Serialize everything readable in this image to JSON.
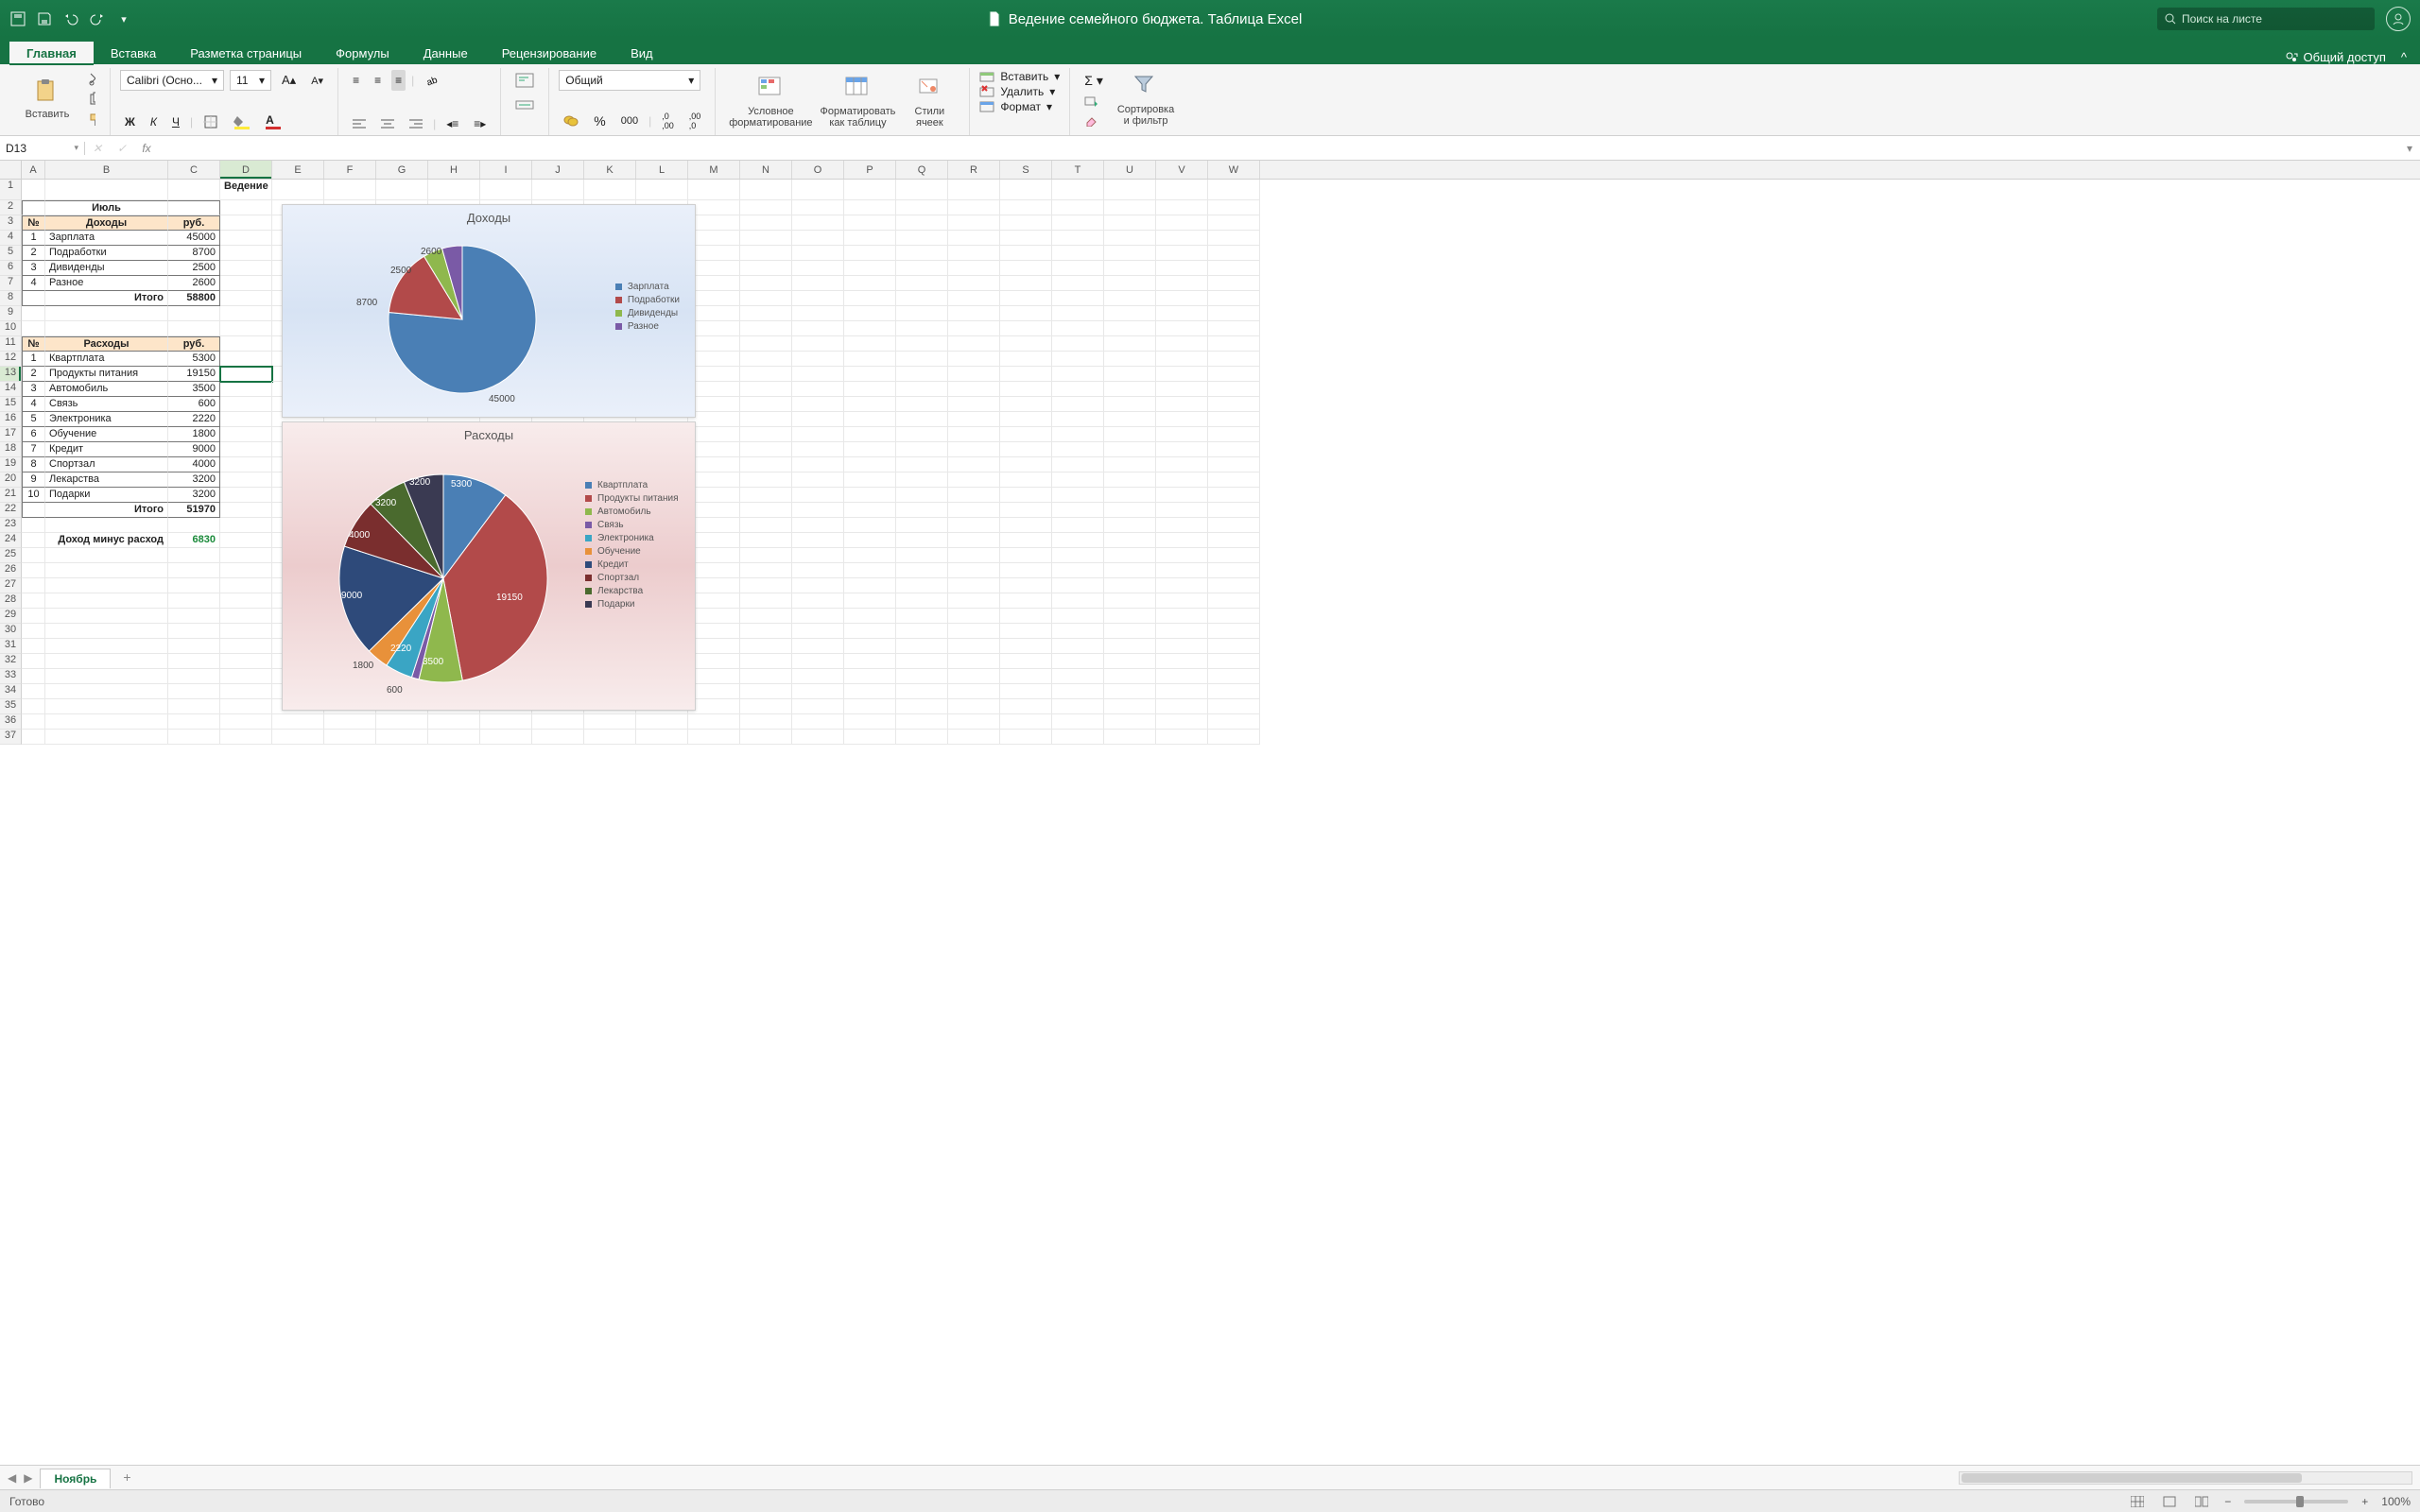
{
  "app": {
    "title": "Ведение семейного бюджета. Таблица Excel",
    "search_placeholder": "Поиск на листе"
  },
  "tabs": [
    "Главная",
    "Вставка",
    "Разметка страницы",
    "Формулы",
    "Данные",
    "Рецензирование",
    "Вид"
  ],
  "share_label": "Общий доступ",
  "ribbon": {
    "paste": "Вставить",
    "font_name": "Calibri (Осно...",
    "font_size": "11",
    "number_format": "Общий",
    "cond_fmt": "Условное\nформатирование",
    "fmt_table": "Форматировать\nкак таблицу",
    "cell_styles": "Стили\nячеек",
    "insert": "Вставить",
    "delete": "Удалить",
    "format": "Формат",
    "sort_filter": "Сортировка\nи фильтр"
  },
  "namebox": "D13",
  "columns": [
    "A",
    "B",
    "C",
    "D",
    "E",
    "F",
    "G",
    "H",
    "I",
    "J",
    "K",
    "L",
    "M",
    "N",
    "O",
    "P",
    "Q",
    "R",
    "S",
    "T",
    "U",
    "V",
    "W"
  ],
  "active": {
    "col": "D",
    "row": 13
  },
  "sheet": {
    "title_cell": "Ведение семейного бюджета в Excel",
    "month": "Июль",
    "income_hdr": {
      "n": "№",
      "name": "Доходы",
      "val": "руб."
    },
    "income": [
      {
        "n": 1,
        "name": "Зарплата",
        "val": 45000
      },
      {
        "n": 2,
        "name": "Подработки",
        "val": 8700
      },
      {
        "n": 3,
        "name": "Дивиденды",
        "val": 2500
      },
      {
        "n": 4,
        "name": "Разное",
        "val": 2600
      }
    ],
    "income_total_label": "Итого",
    "income_total": 58800,
    "expense_hdr": {
      "n": "№",
      "name": "Расходы",
      "val": "руб."
    },
    "expense": [
      {
        "n": 1,
        "name": "Квартплата",
        "val": 5300
      },
      {
        "n": 2,
        "name": "Продукты питания",
        "val": 19150
      },
      {
        "n": 3,
        "name": "Автомобиль",
        "val": 3500
      },
      {
        "n": 4,
        "name": "Связь",
        "val": 600
      },
      {
        "n": 5,
        "name": "Электроника",
        "val": 2220
      },
      {
        "n": 6,
        "name": "Обучение",
        "val": 1800
      },
      {
        "n": 7,
        "name": "Кредит",
        "val": 9000
      },
      {
        "n": 8,
        "name": "Спортзал",
        "val": 4000
      },
      {
        "n": 9,
        "name": "Лекарства",
        "val": 3200
      },
      {
        "n": 10,
        "name": "Подарки",
        "val": 3200
      }
    ],
    "expense_total_label": "Итого",
    "expense_total": 51970,
    "net_label": "Доход минус расход",
    "net": 6830
  },
  "sheet_tab": "Ноябрь",
  "status": {
    "ready": "Готово",
    "zoom": "100%"
  },
  "chart_data": [
    {
      "type": "pie",
      "title": "Доходы",
      "series": [
        {
          "name": "Доходы",
          "values": [
            45000,
            8700,
            2500,
            2600
          ]
        }
      ],
      "categories": [
        "Зарплата",
        "Подработки",
        "Дивиденды",
        "Разное"
      ],
      "colors": [
        "#4a7fb5",
        "#b24a4a",
        "#8fb84d",
        "#7a5aa6"
      ]
    },
    {
      "type": "pie",
      "title": "Расходы",
      "series": [
        {
          "name": "Расходы",
          "values": [
            5300,
            19150,
            3500,
            600,
            2220,
            1800,
            9000,
            4000,
            3200,
            3200
          ]
        }
      ],
      "categories": [
        "Квартплата",
        "Продукты питания",
        "Автомобиль",
        "Связь",
        "Электроника",
        "Обучение",
        "Кредит",
        "Спортзал",
        "Лекарства",
        "Подарки"
      ],
      "colors": [
        "#4a7fb5",
        "#b24a4a",
        "#8fb84d",
        "#7a5aa6",
        "#3aa5c4",
        "#e8913a",
        "#2e4a7a",
        "#7a2e2e",
        "#4a6a2e",
        "#3a3a52"
      ]
    }
  ]
}
